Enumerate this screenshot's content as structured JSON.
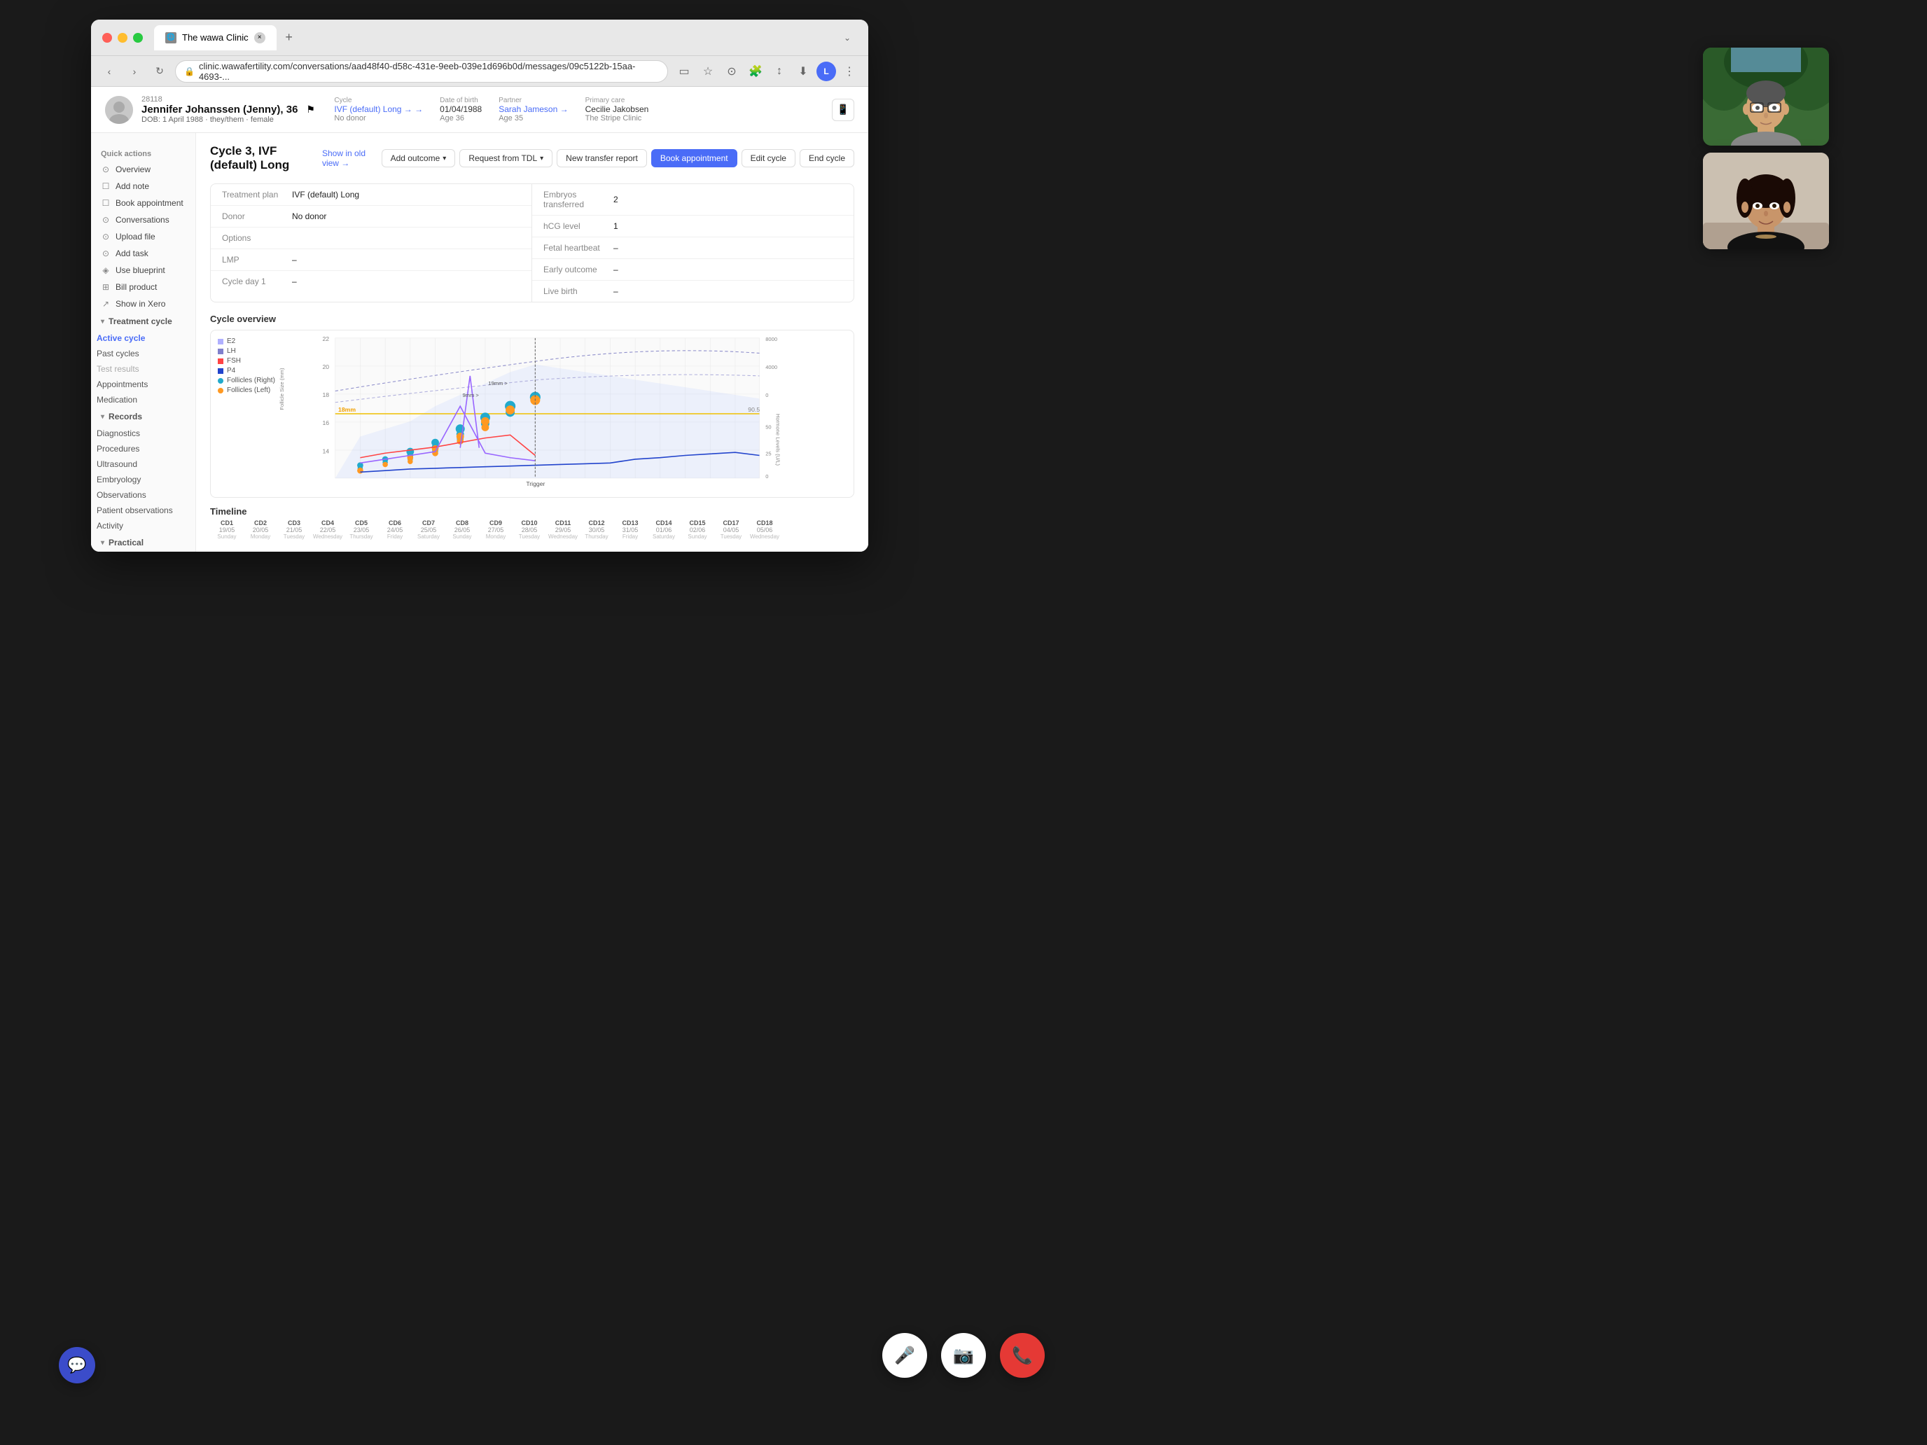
{
  "browser": {
    "tab_title": "The wawa Clinic",
    "address": "clinic.wawafertility.com/conversations/aad48f40-d58c-431e-9eeb-039e1d696b0d/messages/09c5122b-15aa-4693-...",
    "profile_initial": "L"
  },
  "patient": {
    "id": "28118",
    "name": "Jennifer Johanssen (Jenny), 36",
    "dob": "DOB: 1 April 1988 · they/them · female",
    "cycle_label": "Cycle",
    "cycle_value": "IVF (default) Long →",
    "cycle_sub": "No donor",
    "dob_label": "Date of birth",
    "dob_value": "01/04/1988",
    "dob_sub": "Age 36",
    "partner_label": "Partner",
    "partner_value": "Sarah Jameson →",
    "partner_sub": "Age 35",
    "primary_care_label": "Primary care",
    "primary_care_value": "Cecilie Jakobsen",
    "primary_care_clinic": "The Stripe Clinic"
  },
  "sidebar": {
    "quick_actions_title": "Quick actions",
    "items": [
      {
        "label": "Overview",
        "icon": "⊙"
      },
      {
        "label": "Add note",
        "icon": "📝"
      },
      {
        "label": "Book appointment",
        "icon": "📅"
      },
      {
        "label": "Conversations",
        "icon": "💬"
      },
      {
        "label": "Upload file",
        "icon": "📎"
      },
      {
        "label": "Add task",
        "icon": "✓"
      },
      {
        "label": "Use blueprint",
        "icon": "◈"
      },
      {
        "label": "Bill product",
        "icon": "⊞"
      },
      {
        "label": "Show in Xero",
        "icon": "↗"
      }
    ],
    "treatment_cycle_title": "Treatment cycle",
    "treatment_items": [
      {
        "label": "Active cycle",
        "active": true
      },
      {
        "label": "Past cycles"
      },
      {
        "label": "Test results"
      },
      {
        "label": "Appointments"
      },
      {
        "label": "Medication"
      }
    ],
    "records_title": "Records",
    "records_items": [
      {
        "label": "Diagnostics"
      },
      {
        "label": "Procedures"
      },
      {
        "label": "Ultrasound"
      },
      {
        "label": "Embryology"
      },
      {
        "label": "Observations"
      },
      {
        "label": "Patient observations"
      },
      {
        "label": "Activity"
      }
    ],
    "practical_title": "Practical"
  },
  "cycle": {
    "title": "Cycle 3, IVF (default) Long",
    "show_old_view": "Show in old view →",
    "actions": [
      {
        "label": "Add outcome",
        "has_dropdown": true
      },
      {
        "label": "Request from TDL",
        "has_dropdown": true
      },
      {
        "label": "New transfer report"
      },
      {
        "label": "Book appointment",
        "is_primary": true
      },
      {
        "label": "Edit cycle"
      },
      {
        "label": "End cycle"
      }
    ]
  },
  "treatment_info": {
    "left": [
      {
        "label": "Treatment plan",
        "value": "IVF (default) Long"
      },
      {
        "label": "Donor",
        "value": "No donor"
      },
      {
        "label": "Options",
        "value": ""
      },
      {
        "label": "LMP",
        "value": "–"
      },
      {
        "label": "Cycle day 1",
        "value": "–"
      }
    ],
    "right": [
      {
        "label": "Embryos transferred",
        "value": "2"
      },
      {
        "label": "hCG level",
        "value": "1"
      },
      {
        "label": "Fetal heartbeat",
        "value": "–"
      },
      {
        "label": "Early outcome",
        "value": "–"
      },
      {
        "label": "Live birth",
        "value": "–"
      }
    ]
  },
  "chart": {
    "title": "Cycle overview",
    "legend": [
      {
        "label": "E2",
        "color": "#b0b0ff",
        "type": "square"
      },
      {
        "label": "LH",
        "color": "#8080ff",
        "type": "square"
      },
      {
        "label": "FSH",
        "color": "#ff4444",
        "type": "square"
      },
      {
        "label": "P4",
        "color": "#2244cc",
        "type": "square"
      },
      {
        "label": "Follicles (Right)",
        "color": "#22aacc",
        "type": "dot"
      },
      {
        "label": "Follicles (Left)",
        "color": "#ff9922",
        "type": "dot"
      }
    ],
    "y_left_max": "22",
    "y_right_max": "8000",
    "label_18mm": "18mm",
    "label_90_5": "90.5",
    "label_trigger": "Trigger",
    "label_50": "50",
    "label_25": "25",
    "annotation_9mm": "9mm >",
    "annotation_19mm": "19mm >"
  },
  "timeline": {
    "title": "Timeline",
    "columns": [
      {
        "cd": "CD1",
        "date": "19/05",
        "day": "Sunday"
      },
      {
        "cd": "CD2",
        "date": "20/05",
        "day": "Monday"
      },
      {
        "cd": "CD3",
        "date": "21/05",
        "day": "Tuesday"
      },
      {
        "cd": "CD4",
        "date": "22/05",
        "day": "Wednesday"
      },
      {
        "cd": "CD5",
        "date": "23/05",
        "day": "Thursday"
      },
      {
        "cd": "CD6",
        "date": "24/05",
        "day": "Friday"
      },
      {
        "cd": "CD7",
        "date": "25/05",
        "day": "Saturday"
      },
      {
        "cd": "CD8",
        "date": "26/05",
        "day": "Sunday"
      },
      {
        "cd": "CD9",
        "date": "27/05",
        "day": "Monday"
      },
      {
        "cd": "CD10",
        "date": "28/05",
        "day": "Tuesday"
      },
      {
        "cd": "CD11",
        "date": "29/05",
        "day": "Wednesday"
      },
      {
        "cd": "CD12",
        "date": "30/05",
        "day": "Thursday"
      },
      {
        "cd": "CD13",
        "date": "31/05",
        "day": "Friday"
      },
      {
        "cd": "CD14",
        "date": "01/06",
        "day": "Saturday"
      },
      {
        "cd": "CD15",
        "date": "02/06",
        "day": "Sunday"
      },
      {
        "cd": "CD17",
        "date": "04/05",
        "day": "Tuesday"
      },
      {
        "cd": "CD18",
        "date": "05/06",
        "day": "Wednesday"
      }
    ]
  },
  "call_controls": {
    "mic_label": "Mute",
    "video_label": "Camera",
    "hangup_label": "End call"
  },
  "chat_widget": {
    "label": "Open chat"
  }
}
